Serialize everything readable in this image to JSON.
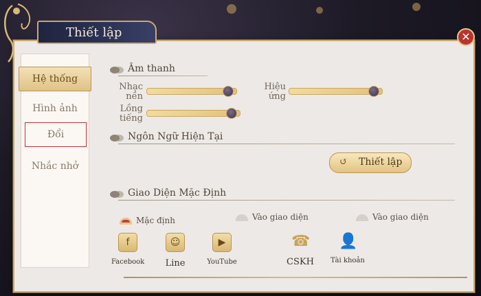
{
  "window": {
    "title": "Thiết lập",
    "close_glyph": "✕"
  },
  "sidebar": {
    "items": [
      {
        "label": "Hệ thống"
      },
      {
        "label": "Hình ảnh"
      },
      {
        "label": "Đổi"
      },
      {
        "label": "Nhắc nhở"
      }
    ]
  },
  "sound": {
    "title": "Âm thanh",
    "music_label": "Nhạc nền",
    "effects_label": "Hiệu ứng",
    "voice_label": "Lồng tiếng",
    "music_level": 0.95,
    "effects_level": 0.95,
    "voice_level": 0.95
  },
  "language": {
    "title": "Ngôn Ngữ Hiện Tại",
    "button_label": "Thiết lập",
    "button_icon": "↺"
  },
  "interface": {
    "title": "Giao Diện Mặc Định",
    "options": [
      {
        "label": "Mặc định",
        "selected": true
      },
      {
        "label": "Vào giao diện",
        "selected": false
      },
      {
        "label": "Vào giao diện",
        "selected": false
      }
    ]
  },
  "links": [
    {
      "label": "Facebook",
      "icon": "facebook-icon",
      "glyph": "f"
    },
    {
      "label": "Line",
      "icon": "line-icon",
      "glyph": "☺"
    },
    {
      "label": "YouTube",
      "icon": "youtube-icon",
      "glyph": "▶"
    },
    {
      "label": "CSKH",
      "icon": "support-icon",
      "glyph": "☎"
    },
    {
      "label": "Tài khoản",
      "icon": "account-icon",
      "glyph": "👤"
    }
  ]
}
